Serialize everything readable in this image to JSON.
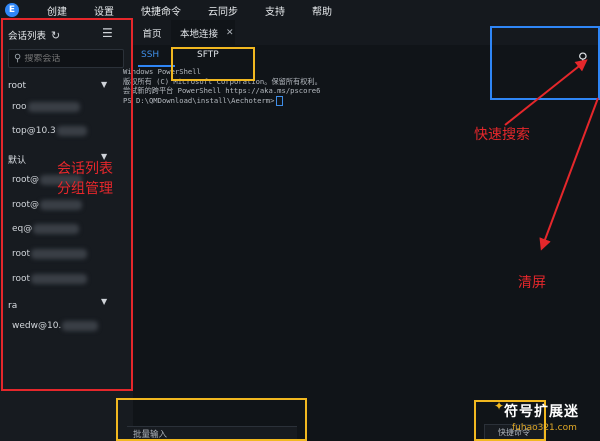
{
  "menu": [
    "创建",
    "设置",
    "快捷命令",
    "云同步",
    "支持",
    "帮助"
  ],
  "logo": "E",
  "sidebar": {
    "title": "会话列表",
    "search_placeholder": "搜索会话",
    "groups": [
      {
        "name": "root",
        "sessions": [
          "roo",
          "top@10.3"
        ]
      },
      {
        "name": "默认",
        "sessions": [
          "root@",
          "root@",
          "eq@",
          "root",
          "root"
        ]
      },
      {
        "name": "ra",
        "sessions": [
          "wedw@10."
        ]
      }
    ]
  },
  "tabs": [
    {
      "label": "首页"
    },
    {
      "label": "本地连接"
    }
  ],
  "subtabs": [
    {
      "label": "SSH"
    },
    {
      "label": "SFTP"
    }
  ],
  "terminal": {
    "lines": [
      "Windows PowerShell",
      "版权所有 (C) Microsoft Corporation。保留所有权利。",
      "",
      "尝试新的跨平台 PowerShell https://aka.ms/pscore6",
      "",
      "PS D:\\QMDownload\\install\\Aechoterm>"
    ]
  },
  "annotations": {
    "session_list": "会话列表",
    "group_manage": "分组管理",
    "quick_search": "快速搜索",
    "clear_screen": "清屏"
  },
  "bottom": {
    "batch_input": "批量输入",
    "quick_command": "快捷命令"
  },
  "watermark": {
    "title": "符号扩展迷",
    "sub": "fuhao321.com"
  },
  "colors": {
    "annotation_red": "#e5272b",
    "annotation_yellow": "#f1b820",
    "annotation_blue": "#2f86f6",
    "accent": "#2f86f6"
  }
}
